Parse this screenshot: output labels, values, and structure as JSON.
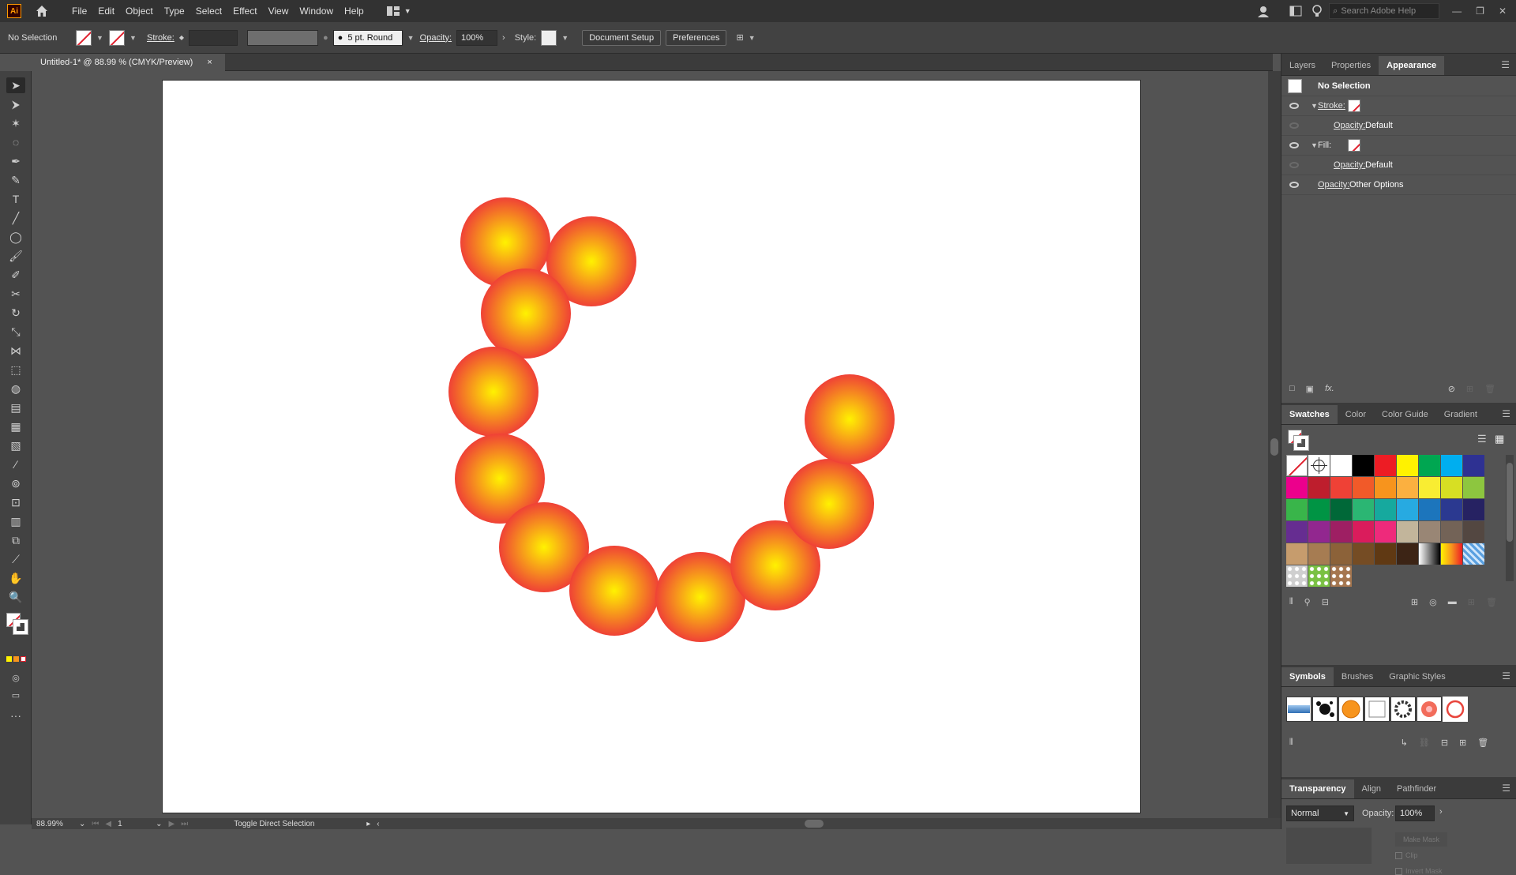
{
  "app": {
    "logo": "Ai",
    "menu": [
      "File",
      "Edit",
      "Object",
      "Type",
      "Select",
      "Effect",
      "View",
      "Window",
      "Help"
    ],
    "search_placeholder": "Search Adobe Help"
  },
  "control_bar": {
    "selection": "No Selection",
    "stroke_label": "Stroke:",
    "brush": "5 pt. Round",
    "opacity_label": "Opacity:",
    "opacity_value": "100%",
    "style_label": "Style:",
    "doc_setup": "Document Setup",
    "preferences": "Preferences"
  },
  "document": {
    "tab_title": "Untitled-1* @ 88.99 % (CMYK/Preview)",
    "close": "×"
  },
  "status": {
    "zoom": "88.99%",
    "artboard": "1",
    "tool_hint": "Toggle Direct Selection"
  },
  "appearance": {
    "tabs": [
      "Layers",
      "Properties",
      "Appearance"
    ],
    "header": "No Selection",
    "stroke_label": "Stroke:",
    "stroke_opacity_label": "Opacity:",
    "stroke_opacity_value": "Default",
    "fill_label": "Fill:",
    "fill_opacity_label": "Opacity:",
    "fill_opacity_value": "Default",
    "opacity_label": "Opacity:",
    "opacity_value": "Other Options"
  },
  "swatches": {
    "tabs": [
      "Swatches",
      "Color",
      "Color Guide",
      "Gradient"
    ],
    "colors": [
      "none",
      "registration",
      "#ffffff",
      "#000000",
      "#ed1c24",
      "#fff200",
      "#00a651",
      "#00aeef",
      "#2e3192",
      "#ec008c",
      "#be1e2d",
      "#ef4136",
      "#f15a29",
      "#f7941d",
      "#fbb040",
      "#f9ed32",
      "#d7df23",
      "#8dc63f",
      "#39b54a",
      "#009444",
      "#006838",
      "#2bb673",
      "#16a99e",
      "#27aae1",
      "#1c75bc",
      "#2b3990",
      "#262262",
      "#662d91",
      "#92278f",
      "#9e1f63",
      "#da1c5c",
      "#ee2a7b",
      "#c2b59b",
      "#998675",
      "#736357",
      "#534741",
      "#c69c6d",
      "#a67c52",
      "#8c6239",
      "#754c24",
      "#603913",
      "#3c2415",
      "gradient-bw",
      "gradient-orange",
      "pattern-blue"
    ]
  },
  "symbols": {
    "tabs": [
      "Symbols",
      "Brushes",
      "Graphic Styles"
    ]
  },
  "transparency": {
    "tabs": [
      "Transparency",
      "Align",
      "Pathfinder"
    ],
    "blend_mode": "Normal",
    "opacity_label": "Opacity:",
    "opacity_value": "100%",
    "make_mask": "Make Mask",
    "clip": "Clip",
    "invert_mask": "Invert Mask"
  },
  "colors": {
    "circle_center": "#fff200",
    "circle_edge": "#ef4136"
  }
}
